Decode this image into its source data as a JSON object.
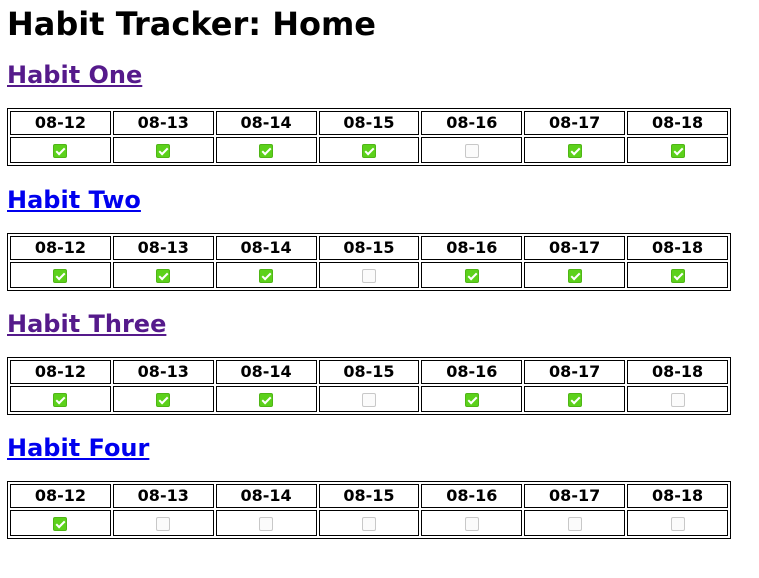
{
  "page": {
    "title": "Habit Tracker: Home"
  },
  "colors": {
    "checked": "#5cd11b",
    "visited_link": "#551a8b",
    "unvisited_link": "#0000ee"
  },
  "habits": [
    {
      "name": "Habit One",
      "link_state": "visited",
      "dates": [
        "08-12",
        "08-13",
        "08-14",
        "08-15",
        "08-16",
        "08-17",
        "08-18"
      ],
      "done": [
        true,
        true,
        true,
        true,
        false,
        true,
        true
      ]
    },
    {
      "name": "Habit Two",
      "link_state": "unvisited",
      "dates": [
        "08-12",
        "08-13",
        "08-14",
        "08-15",
        "08-16",
        "08-17",
        "08-18"
      ],
      "done": [
        true,
        true,
        true,
        false,
        true,
        true,
        true
      ]
    },
    {
      "name": "Habit Three",
      "link_state": "visited",
      "dates": [
        "08-12",
        "08-13",
        "08-14",
        "08-15",
        "08-16",
        "08-17",
        "08-18"
      ],
      "done": [
        true,
        true,
        true,
        false,
        true,
        true,
        false
      ]
    },
    {
      "name": "Habit Four",
      "link_state": "unvisited",
      "dates": [
        "08-12",
        "08-13",
        "08-14",
        "08-15",
        "08-16",
        "08-17",
        "08-18"
      ],
      "done": [
        true,
        false,
        false,
        false,
        false,
        false,
        false
      ]
    }
  ]
}
